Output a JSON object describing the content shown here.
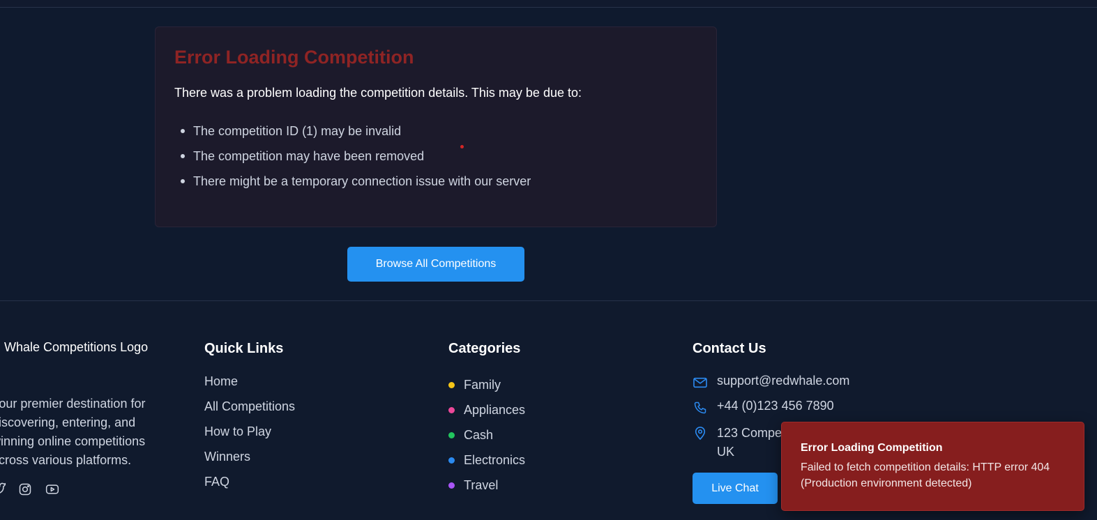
{
  "error_card": {
    "title": "Error Loading Competition",
    "description": "There was a problem loading the competition details. This may be due to:",
    "reasons": [
      "The competition ID (1) may be invalid",
      "The competition may have been removed",
      "There might be a temporary connection issue with our server"
    ],
    "title_color": "#8f2424"
  },
  "browse_button": {
    "label": "Browse All Competitions",
    "color": "#2491f0"
  },
  "footer": {
    "logo_alt_text": "Red Whale Competitions Logo",
    "about": "Your premier destination for discovering, entering, and winning online competitions across various platforms.",
    "social_icons": [
      "twitter-icon",
      "instagram-icon",
      "youtube-icon"
    ],
    "quick_links": {
      "heading": "Quick Links",
      "items": [
        "Home",
        "All Competitions",
        "How to Play",
        "Winners",
        "FAQ"
      ]
    },
    "categories": {
      "heading": "Categories",
      "items": [
        {
          "label": "Family",
          "color": "#f5c518"
        },
        {
          "label": "Appliances",
          "color": "#ec4899"
        },
        {
          "label": "Cash",
          "color": "#22c55e"
        },
        {
          "label": "Electronics",
          "color": "#2b8af0"
        },
        {
          "label": "Travel",
          "color": "#a855f7"
        }
      ]
    },
    "contact": {
      "heading": "Contact Us",
      "email": "support@redwhale.com",
      "phone": "+44 (0)123 456 7890",
      "address_line1": "123 Compe",
      "address_line2": "UK",
      "live_chat_label": "Live Chat",
      "icon_color": "#2b8af0"
    }
  },
  "toast": {
    "title": "Error Loading Competition",
    "message": "Failed to fetch competition details: HTTP error 404 (Production environment detected)",
    "background": "#861e1e"
  }
}
